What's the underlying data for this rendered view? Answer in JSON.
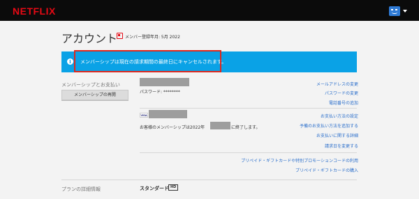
{
  "header": {
    "logo": "NETFLIX"
  },
  "page": {
    "title": "アカウント",
    "member_since": "メンバー登録年月: 5月 2022"
  },
  "banner": {
    "icon_symbol": "i",
    "message": "メンバーシップは現在の請求期間の最終日にキャンセルされます。",
    "color": "#0aa2e6"
  },
  "membership": {
    "section_label": "メンバーシップとお支払い",
    "restart_button": "メンバーシップの再開",
    "password_label": "パスワード: ********",
    "card_brand": "VISA",
    "end_notice_before": "お客様のメンバーシップは2022年",
    "end_notice_after": "に終了します。",
    "links_account": [
      "メールアドレスの変更",
      "パスワードの変更",
      "電話番号の追加"
    ],
    "links_payment": [
      "お支払い方法の設定",
      "予備のお支払い方法を追加する",
      "お支払いに関する詳細",
      "請求日を変更する"
    ],
    "links_gift": [
      "プリペイド・ギフトカードや特別プロモーションコードの利用",
      "プリペイド・ギフトカードの購入"
    ]
  },
  "plan": {
    "section_label": "プランの詳細情報",
    "name": "スタンダード",
    "badge": "HD"
  },
  "colors": {
    "brand": "#e50914",
    "link": "#2a6ecb",
    "highlight": "#e0261b"
  }
}
